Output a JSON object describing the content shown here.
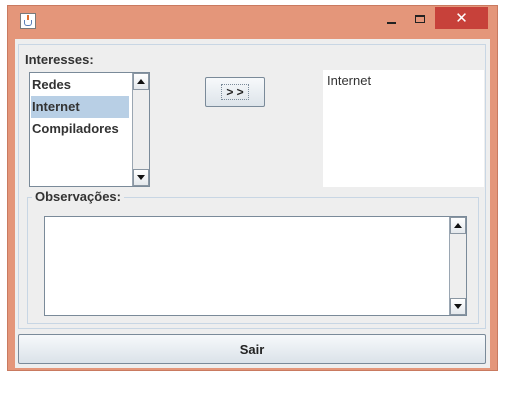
{
  "window": {
    "title": "",
    "close_glyph": "✕",
    "colors": {
      "frame": "#e4967a",
      "close": "#c7413a",
      "selection": "#b8cfe5"
    }
  },
  "interesses": {
    "legend": "Interesses:",
    "items": [
      "Redes",
      "Internet",
      "Compiladores"
    ],
    "selected_index": 1,
    "transfer_button": "> >",
    "selected_items": [
      "Internet"
    ]
  },
  "observacoes": {
    "legend": "Observações:",
    "value": ""
  },
  "footer": {
    "exit_button": "Sair"
  }
}
